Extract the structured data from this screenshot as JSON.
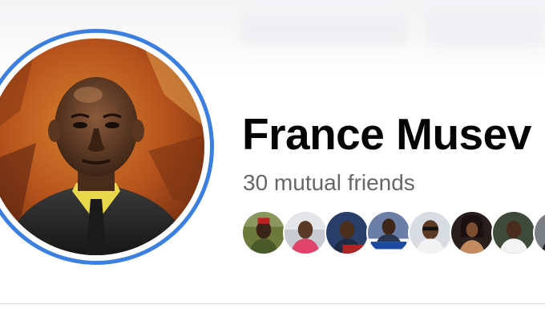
{
  "profile": {
    "name": "France Musev",
    "mutual_friends": "30 mutual friends"
  },
  "colors": {
    "avatar_ring": "#3b7fe0",
    "name_text": "#050505",
    "secondary_text": "#65676b",
    "divider": "#d9dbdf"
  },
  "mutual_friends_avatars": [
    {
      "icon": "friend-avatar-1"
    },
    {
      "icon": "friend-avatar-2"
    },
    {
      "icon": "friend-avatar-3"
    },
    {
      "icon": "friend-avatar-4"
    },
    {
      "icon": "friend-avatar-5"
    },
    {
      "icon": "friend-avatar-6"
    },
    {
      "icon": "friend-avatar-7"
    },
    {
      "icon": "friend-avatar-8"
    }
  ]
}
